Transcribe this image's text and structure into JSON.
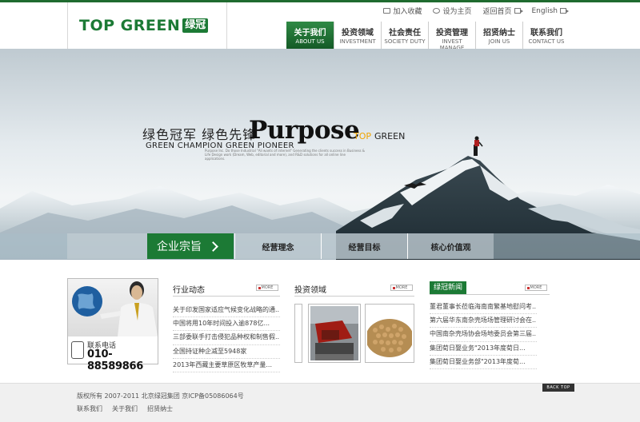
{
  "header": {
    "logo_text": "TOP GREEN",
    "logo_cn": "绿冠",
    "utility": [
      {
        "label": "加入收藏",
        "icon": "mail-icon"
      },
      {
        "label": "设为主页",
        "icon": "home-icon"
      },
      {
        "label": "返回首页",
        "icon": "return-icon"
      },
      {
        "label": "English",
        "icon": "arrow-icon"
      }
    ],
    "nav": [
      {
        "cn": "关于我们",
        "en": "ABOUT US",
        "active": true
      },
      {
        "cn": "投资领域",
        "en": "INVESTMENT"
      },
      {
        "cn": "社会责任",
        "en": "SOCIETY DUTY"
      },
      {
        "cn": "投资管理",
        "en": "INVEST MANAGE"
      },
      {
        "cn": "招贤纳士",
        "en": "JOIN US"
      },
      {
        "cn": "联系我们",
        "en": "CONTACT US"
      }
    ]
  },
  "banner": {
    "slogan_cn": "绿色冠军  绿色先锋",
    "slogan_en": "GREEN CHAMPION GREEN PIONEER",
    "slogan_big": "Purpose",
    "slogan_top": "TOP",
    "slogan_green": "GREEN",
    "slogan_small": "Purpose Inc. Do those Industrial \"Ali wants of internet\" Generating the clients success in Business & Life Design work (Dream, Web, editorial and more), and R&D solutions for all online line applications.",
    "tab_main": "企业宗旨",
    "tabs": [
      "经营理念",
      "经营目标",
      "核心价值观"
    ]
  },
  "contact": {
    "label": "联系电话",
    "phone": "010-88589866"
  },
  "industry": {
    "title": "行业动态",
    "more": "MORE",
    "items": [
      "关于印发国家适应气候变化战略的通...",
      "中国将用10年时间投入逾878亿...",
      "三部委联手打击侵犯品种权和制售假...",
      "全国持证种企减至5948家",
      "2013年西藏主要草原区牧草产量..."
    ]
  },
  "investment": {
    "title": "投资领域",
    "more": "MORE"
  },
  "green_news": {
    "title": "绿冠新闻",
    "more": "MORE",
    "items": [
      "董君董事长莅临海南南繁基地慰问考...",
      "第六届华东南杂壳场场管理研讨会在...",
      "中国南杂壳场协会场地委员会第三届...",
      "集团荀日娶业务\"2013年度荀日...",
      "集团荀日娶业务部\"2013年度荀..."
    ]
  },
  "footer": {
    "copyright": "版权所有 2007-2011  北京绿冠集团  京ICP备05086064号",
    "links": [
      "联系我们",
      "关于我们",
      "招贤纳士"
    ],
    "back_top": "BACK TOP"
  }
}
